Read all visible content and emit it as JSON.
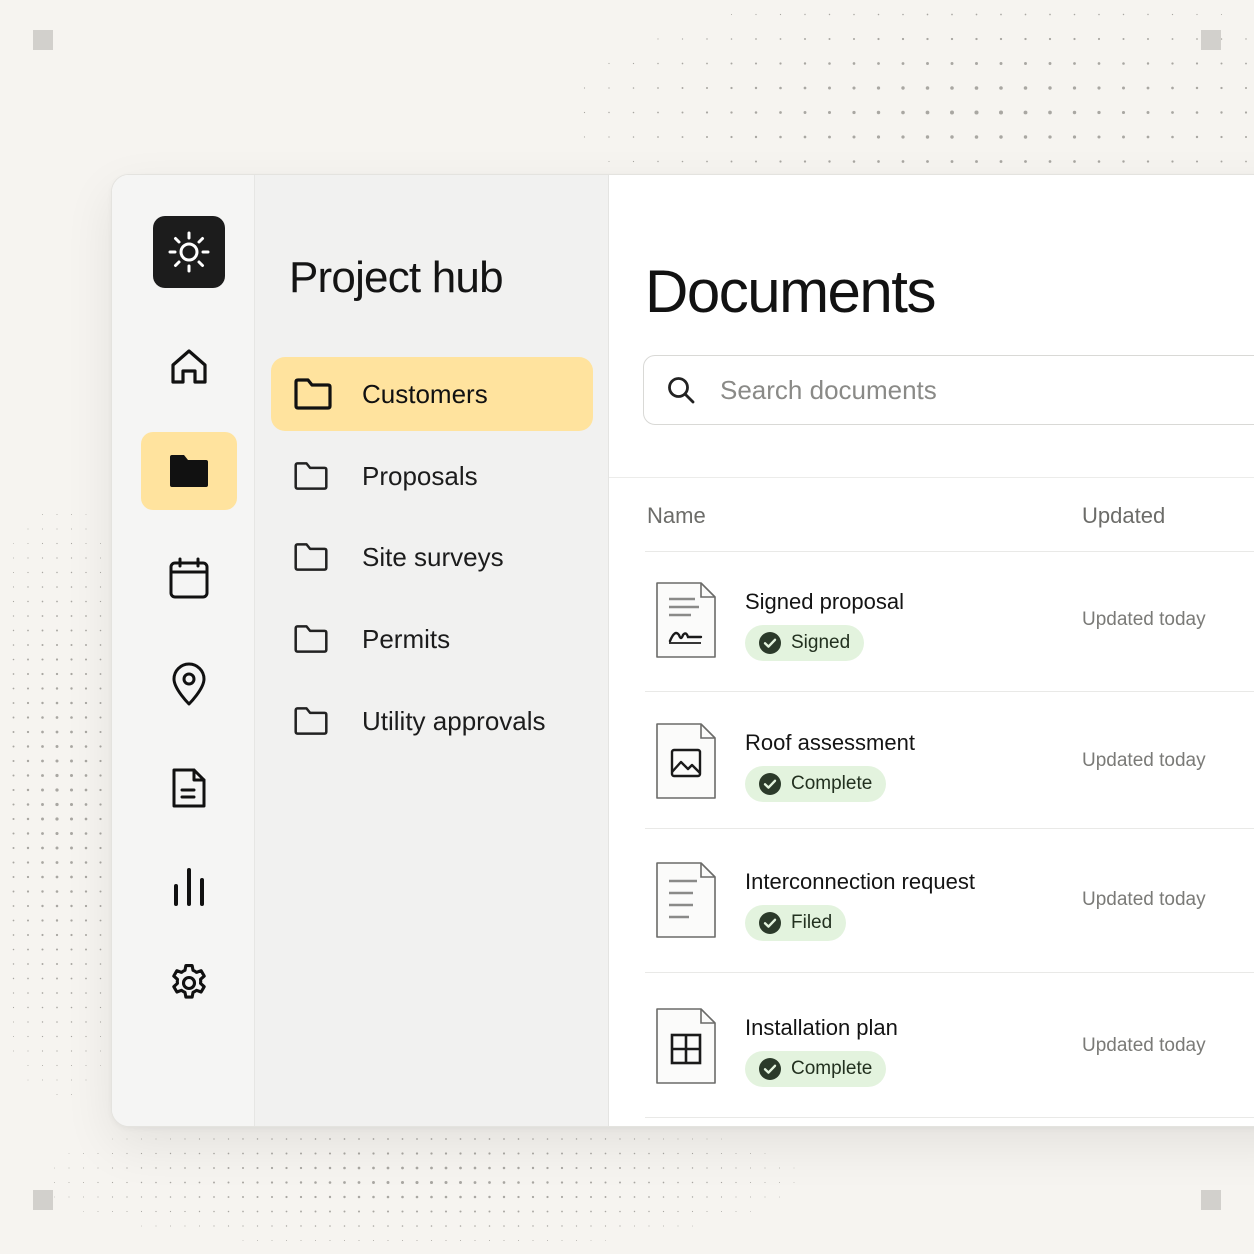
{
  "sidebar": {
    "brand_icon": "sun-icon",
    "items": [
      {
        "id": "home",
        "icon": "home-icon",
        "active": false
      },
      {
        "id": "folders",
        "icon": "folder-icon",
        "active": true
      },
      {
        "id": "calendar",
        "icon": "calendar-icon",
        "active": false
      },
      {
        "id": "locations",
        "icon": "map-pin-icon",
        "active": false
      },
      {
        "id": "documents",
        "icon": "document-icon",
        "active": false
      },
      {
        "id": "analytics",
        "icon": "bar-chart-icon",
        "active": false
      },
      {
        "id": "settings",
        "icon": "gear-icon",
        "active": false
      }
    ]
  },
  "folders": {
    "title": "Project hub",
    "items": [
      {
        "label": "Customers",
        "active": true
      },
      {
        "label": "Proposals",
        "active": false
      },
      {
        "label": "Site surveys",
        "active": false
      },
      {
        "label": "Permits",
        "active": false
      },
      {
        "label": "Utility approvals",
        "active": false
      }
    ]
  },
  "main": {
    "title": "Documents",
    "search": {
      "placeholder": "Search documents",
      "value": ""
    },
    "columns": {
      "name": "Name",
      "updated": "Updated"
    },
    "rows": [
      {
        "name": "Signed proposal",
        "status": "Signed",
        "updated": "Updated today",
        "icon": "signature-document-icon"
      },
      {
        "name": "Roof assessment",
        "status": "Complete",
        "updated": "Updated today",
        "icon": "image-document-icon"
      },
      {
        "name": "Interconnection request",
        "status": "Filed",
        "updated": "Updated today",
        "icon": "text-document-icon"
      },
      {
        "name": "Installation plan",
        "status": "Complete",
        "updated": "Updated today",
        "icon": "grid-document-icon"
      }
    ]
  },
  "colors": {
    "accent": "#ffe39e",
    "badge_bg": "#e3f3de",
    "logo_bg": "#1c1c1c"
  }
}
